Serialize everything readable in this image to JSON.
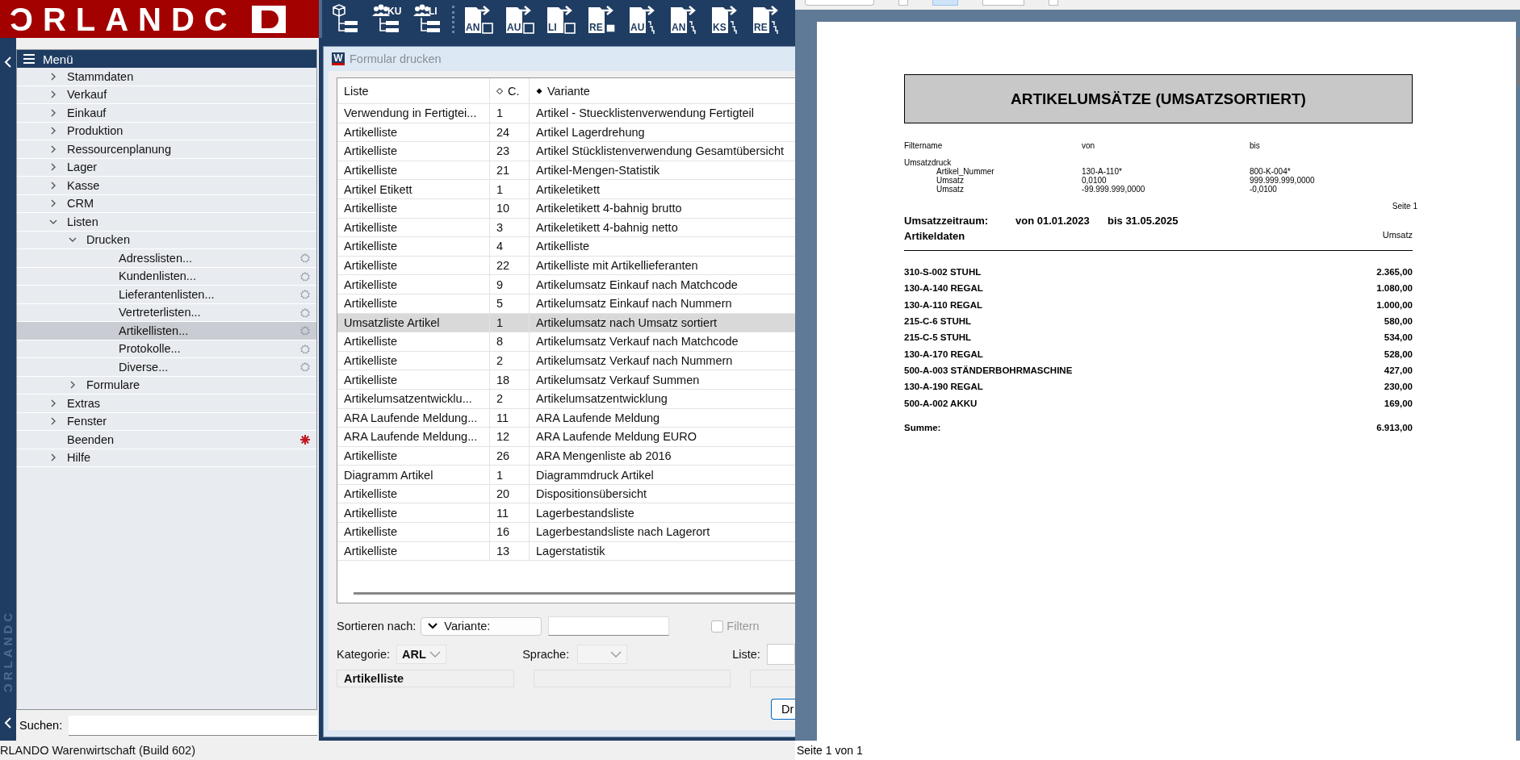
{
  "logo": {
    "text": "ƆRLANDC"
  },
  "toolbar": [
    {
      "kind": "tree"
    },
    {
      "kind": "people",
      "label": "KU"
    },
    {
      "kind": "people",
      "label": "LI"
    },
    {
      "kind": "doc-box",
      "label": "AN"
    },
    {
      "kind": "doc-box",
      "label": "AU"
    },
    {
      "kind": "doc-box",
      "label": "LI"
    },
    {
      "kind": "doc-cal",
      "label": "RE"
    },
    {
      "kind": "doc-steps",
      "label": "AU"
    },
    {
      "kind": "doc-steps",
      "label": "AN"
    },
    {
      "kind": "doc-steps",
      "label": "KS"
    },
    {
      "kind": "doc-steps",
      "label": "RE"
    }
  ],
  "strip_logo": "ƆRLANDC",
  "sidebar": {
    "title": "Menü",
    "items": [
      {
        "label": "Stammdaten",
        "kind": "folder",
        "expanded": false,
        "selected": false
      },
      {
        "label": "Verkauf",
        "kind": "folder",
        "expanded": false,
        "selected": false
      },
      {
        "label": "Einkauf",
        "kind": "folder",
        "expanded": false,
        "selected": false
      },
      {
        "label": "Produktion",
        "kind": "folder",
        "expanded": false,
        "selected": false
      },
      {
        "label": "Ressourcenplanung",
        "kind": "folder",
        "expanded": false,
        "selected": false
      },
      {
        "label": "Lager",
        "kind": "folder",
        "expanded": false,
        "selected": false
      },
      {
        "label": "Kasse",
        "kind": "folder",
        "expanded": false,
        "selected": false
      },
      {
        "label": "CRM",
        "kind": "folder",
        "expanded": false,
        "selected": false
      },
      {
        "label": "Listen",
        "kind": "folder",
        "expanded": true,
        "selected": false,
        "children": [
          {
            "label": "Drucken",
            "kind": "folder",
            "expanded": true,
            "selected": false,
            "children": [
              {
                "label": "Adresslisten...",
                "kind": "action",
                "selected": false
              },
              {
                "label": "Kundenlisten...",
                "kind": "action",
                "selected": false
              },
              {
                "label": "Lieferantenlisten...",
                "kind": "action",
                "selected": false
              },
              {
                "label": "Vertreterlisten...",
                "kind": "action",
                "selected": false
              },
              {
                "label": "Artikellisten...",
                "kind": "action",
                "selected": true
              },
              {
                "label": "Protokolle...",
                "kind": "action",
                "selected": false
              },
              {
                "label": "Diverse...",
                "kind": "action",
                "selected": false
              }
            ]
          },
          {
            "label": "Formulare",
            "kind": "folder",
            "expanded": false,
            "selected": false
          }
        ]
      },
      {
        "label": "Extras",
        "kind": "folder",
        "expanded": false,
        "selected": false
      },
      {
        "label": "Fenster",
        "kind": "folder",
        "expanded": false,
        "selected": false
      },
      {
        "label": "Beenden",
        "kind": "exit",
        "selected": false
      },
      {
        "label": "Hilfe",
        "kind": "folder",
        "expanded": false,
        "selected": false
      }
    ],
    "search": {
      "label": "Suchen:"
    }
  },
  "dialog": {
    "app_icon": "W",
    "title": "Formular drucken",
    "columns": [
      "Liste",
      "C.",
      "Variante"
    ],
    "rows": [
      {
        "cells": [
          "Verwendung in Fertigtei...",
          "1",
          "Artikel - Stuecklistenverwendung Fertigteil"
        ],
        "selected": false
      },
      {
        "cells": [
          "Artikelliste",
          "24",
          "Artikel Lagerdrehung"
        ],
        "selected": false
      },
      {
        "cells": [
          "Artikelliste",
          "23",
          "Artikel Stücklistenverwendung Gesamtübersicht"
        ],
        "selected": false
      },
      {
        "cells": [
          "Artikelliste",
          "21",
          "Artikel-Mengen-Statistik"
        ],
        "selected": false
      },
      {
        "cells": [
          "Artikel Etikett",
          "1",
          "Artikeletikett"
        ],
        "selected": false
      },
      {
        "cells": [
          "Artikelliste",
          "10",
          "Artikeletikett 4-bahnig brutto"
        ],
        "selected": false
      },
      {
        "cells": [
          "Artikelliste",
          "3",
          "Artikeletikett 4-bahnig netto"
        ],
        "selected": false
      },
      {
        "cells": [
          "Artikelliste",
          "4",
          "Artikelliste"
        ],
        "selected": false
      },
      {
        "cells": [
          "Artikelliste",
          "22",
          "Artikelliste mit Artikellieferanten"
        ],
        "selected": false
      },
      {
        "cells": [
          "Artikelliste",
          "9",
          "Artikelumsatz Einkauf nach Matchcode"
        ],
        "selected": false
      },
      {
        "cells": [
          "Artikelliste",
          "5",
          "Artikelumsatz Einkauf nach Nummern"
        ],
        "selected": false
      },
      {
        "cells": [
          "Umsatzliste Artikel",
          "1",
          "Artikelumsatz nach Umsatz sortiert"
        ],
        "selected": true
      },
      {
        "cells": [
          "Artikelliste",
          "8",
          "Artikelumsatz Verkauf nach Matchcode"
        ],
        "selected": false
      },
      {
        "cells": [
          "Artikelliste",
          "2",
          "Artikelumsatz Verkauf nach Nummern"
        ],
        "selected": false
      },
      {
        "cells": [
          "Artikelliste",
          "18",
          "Artikelumsatz Verkauf Summen"
        ],
        "selected": false
      },
      {
        "cells": [
          "Artikelumsatzentwicklu...",
          "2",
          "Artikelumsatzentwicklung"
        ],
        "selected": false
      },
      {
        "cells": [
          "ARA Laufende Meldung...",
          "11",
          "ARA Laufende Meldung"
        ],
        "selected": false
      },
      {
        "cells": [
          "ARA Laufende Meldung...",
          "12",
          "ARA Laufende Meldung EURO"
        ],
        "selected": false
      },
      {
        "cells": [
          "Artikelliste",
          "26",
          "ARA Mengenliste ab 2016"
        ],
        "selected": false
      },
      {
        "cells": [
          "Diagramm Artikel",
          "1",
          "Diagrammdruck Artikel"
        ],
        "selected": false
      },
      {
        "cells": [
          "Artikelliste",
          "20",
          "Dispositionsübersicht"
        ],
        "selected": false
      },
      {
        "cells": [
          "Artikelliste",
          "11",
          "Lagerbestandsliste"
        ],
        "selected": false
      },
      {
        "cells": [
          "Artikelliste",
          "16",
          "Lagerbestandsliste nach Lagerort"
        ],
        "selected": false
      },
      {
        "cells": [
          "Artikelliste",
          "13",
          "Lagerstatistik"
        ],
        "selected": false
      }
    ],
    "sort": {
      "label": "Sortieren nach:",
      "value": "Variante:"
    },
    "filter": {
      "label": "Filtern",
      "checked": false,
      "disabled": true
    },
    "category": {
      "label": "Kategorie:",
      "value": "ARL"
    },
    "language": {
      "label": "Sprache:"
    },
    "list": {
      "label": "Liste:"
    },
    "category_name": "Artikelliste",
    "print_button": "Dr"
  },
  "preview": {
    "report": {
      "title": "ARTIKELUMSÄTZE (UMSATZSORTIERT)",
      "filter_header": [
        "Filtername",
        "von",
        "bis"
      ],
      "filter_group": "Umsatzdruck",
      "filters": [
        {
          "name": "Artikel_Nummer",
          "from": "130-A-110*",
          "to": "800-K-004*"
        },
        {
          "name": "Umsatz",
          "from": "0,0100",
          "to": "999.999.999,0000"
        },
        {
          "name": "Umsatz",
          "from": "-99.999.999,0000",
          "to": "-0,0100"
        }
      ],
      "page": "Seite 1",
      "period": {
        "label": "Umsatzzeitraum:",
        "from": "von 01.01.2023",
        "to": "bis 31.05.2025"
      },
      "columns": [
        "Artikeldaten",
        "Umsatz"
      ],
      "rows": [
        {
          "article": "310-S-002 STUHL",
          "value": "2.365,00"
        },
        {
          "article": "130-A-140 REGAL",
          "value": "1.080,00"
        },
        {
          "article": "130-A-110 REGAL",
          "value": "1.000,00"
        },
        {
          "article": "215-C-6 STUHL",
          "value": "580,00"
        },
        {
          "article": "215-C-5 STUHL",
          "value": "534,00"
        },
        {
          "article": "130-A-170 REGAL",
          "value": "528,00"
        },
        {
          "article": "500-A-003 STÄNDERBOHRMASCHINE",
          "value": "427,00"
        },
        {
          "article": "130-A-190 REGAL",
          "value": "230,00"
        },
        {
          "article": "500-A-002 AKKU",
          "value": "169,00"
        }
      ],
      "total": {
        "label": "Summe:",
        "value": "6.913,00"
      }
    },
    "status": "Seite 1 von 1"
  },
  "status_bar": "RLANDO Warenwirtschaft (Build 602)"
}
